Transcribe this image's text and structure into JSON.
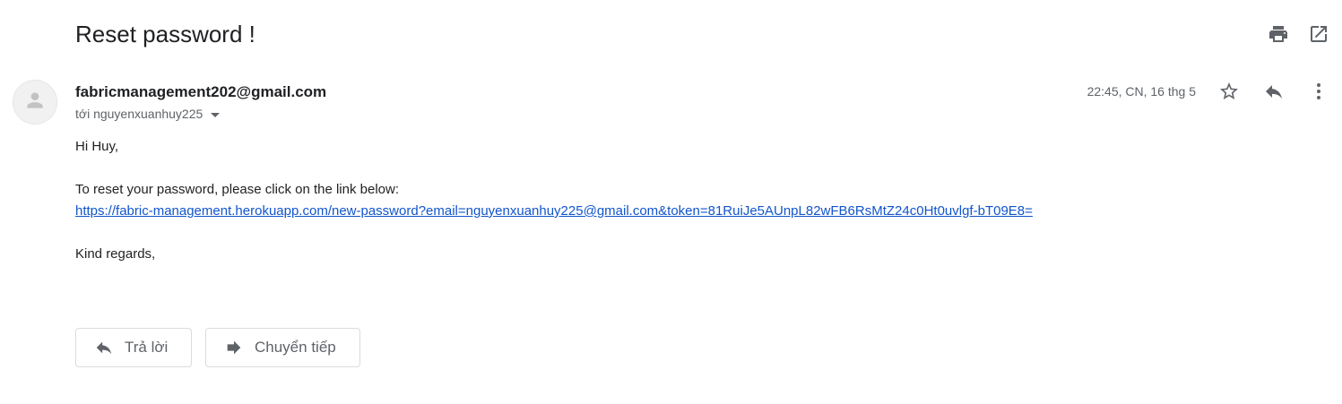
{
  "email": {
    "subject": "Reset password !",
    "sender": "fabricmanagement202@gmail.com",
    "recipient": "tới nguyenxuanhuy225",
    "date": "22:45, CN, 16 thg 5",
    "body": {
      "greeting": "Hi Huy,",
      "instruction": "To reset your password, please click on the link below:",
      "link": "https://fabric-management.herokuapp.com/new-password?email=nguyenxuanhuy225@gmail.com&token=81RuiJe5AUnpL82wFB6RsMtZ24c0Ht0uvlgf-bT09E8=",
      "closing": "Kind regards,"
    }
  },
  "actions": {
    "reply_label": "Trả lời",
    "forward_label": "Chuyển tiếp"
  },
  "icons": {
    "print": "print-icon",
    "open_new_window": "open-in-new-window-icon",
    "avatar": "default-avatar-icon",
    "recipient_dropdown": "caret-down-icon",
    "star": "star-icon",
    "reply": "reply-icon",
    "more": "more-vertical-icon",
    "forward": "forward-icon"
  },
  "colors": {
    "link": "#1155cc",
    "icon": "#5f6368",
    "text": "#202124"
  }
}
